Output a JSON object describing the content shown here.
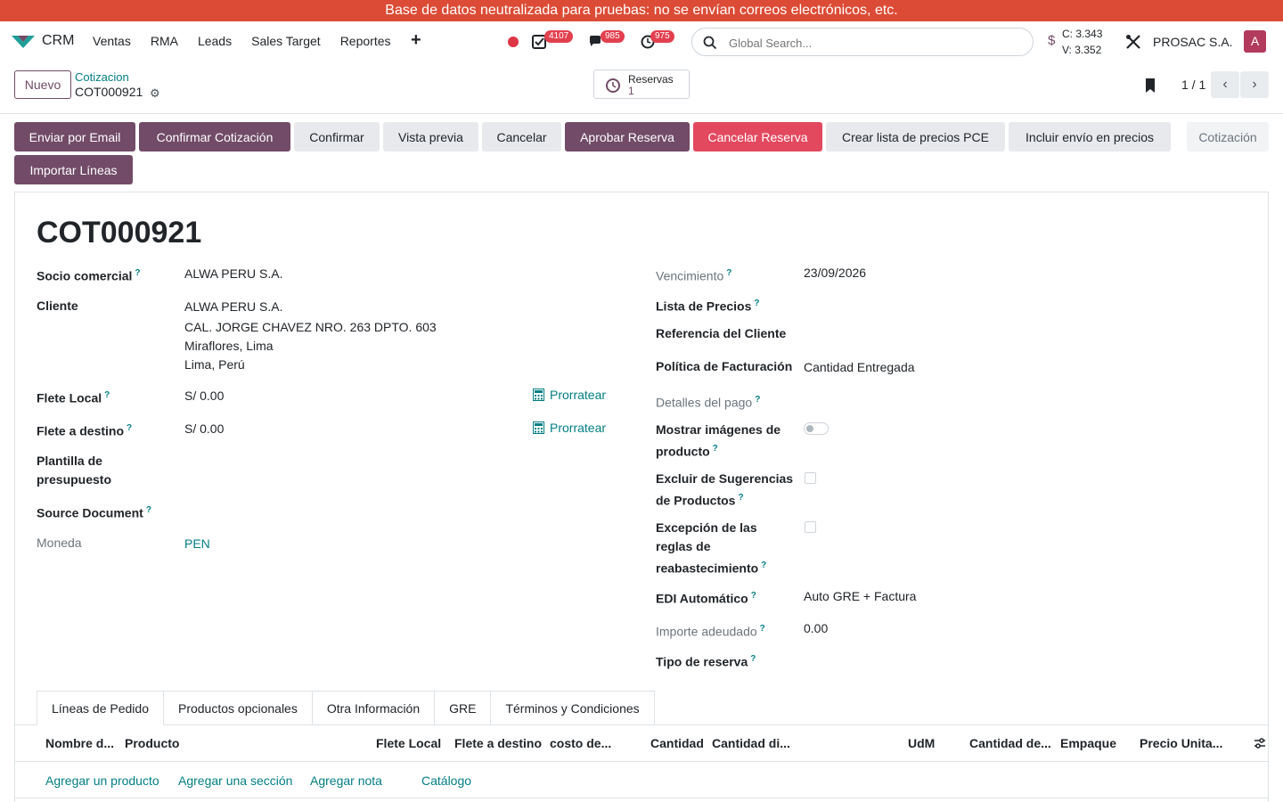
{
  "banner": "Base de datos neutralizada para pruebas: no se envían correos electrónicos, etc.",
  "navbar": {
    "app_name": "CRM",
    "menu": [
      "Ventas",
      "RMA",
      "Leads",
      "Sales Target",
      "Reportes"
    ],
    "badges": {
      "activities": "4107",
      "messages": "985",
      "timers": "975"
    },
    "search_placeholder": "Global Search...",
    "currency_symbol": "$",
    "rate_buy": "C: 3.343",
    "rate_sell": "V: 3.352",
    "company": "PROSAC S.A.",
    "avatar_initial": "A"
  },
  "control": {
    "new_label": "Nuevo",
    "breadcrumb_parent": "Cotizacion",
    "breadcrumb_current": "COT000921",
    "reservas_label": "Reservas",
    "reservas_count": "1",
    "pager": "1 / 1"
  },
  "actions": {
    "send_email": "Enviar por Email",
    "confirm_quote": "Confirmar Cotización",
    "confirm": "Confirmar",
    "preview": "Vista previa",
    "cancel": "Cancelar",
    "approve_reservation": "Aprobar Reserva",
    "cancel_reservation": "Cancelar Reserva",
    "create_pricelist": "Crear lista de precios PCE",
    "include_shipping": "Incluir envío en precios",
    "status": "Cotización",
    "import_lines": "Importar Líneas"
  },
  "form": {
    "title": "COT000921",
    "partner_label": "Socio comercial",
    "partner": "ALWA PERU S.A.",
    "client_label": "Cliente",
    "client_name": "ALWA PERU S.A.",
    "client_street": "CAL. JORGE CHAVEZ NRO. 263 DPTO. 603",
    "client_city": "Miraflores, Lima",
    "client_country": "Lima, Perú",
    "local_freight_label": "Flete Local",
    "local_freight": "S/ 0.00",
    "dest_freight_label": "Flete a destino",
    "dest_freight": "S/ 0.00",
    "prorate": "Prorratear",
    "template_label": "Plantilla de presupuesto",
    "source_label": "Source Document",
    "currency_label": "Moneda",
    "currency": "PEN",
    "expiration_label": "Vencimiento",
    "expiration": "23/09/2026",
    "pricelist_label": "Lista de Precios",
    "customer_ref_label": "Referencia del Cliente",
    "invoice_policy_label": "Política de Facturación",
    "invoice_policy": "Cantidad Entregada",
    "payment_details_label": "Detalles del pago",
    "show_images_label": "Mostrar imágenes de producto",
    "exclude_suggestions_label": "Excluir de Sugerencias de Productos",
    "replenish_exception_label": "Excepción de las reglas de reabastecimiento",
    "edi_label": "EDI Automático",
    "edi": "Auto GRE + Factura",
    "amount_due_label": "Importe adeudado",
    "amount_due": "0.00",
    "reservation_type_label": "Tipo de reserva"
  },
  "tabs": [
    "Líneas de Pedido",
    "Productos opcionales",
    "Otra Información",
    "GRE",
    "Términos y Condiciones"
  ],
  "table": {
    "columns": [
      "Nombre d...",
      "Producto",
      "Flete Local",
      "Flete a destino",
      "costo de...",
      "Cantidad",
      "Cantidad di...",
      "UdM",
      "Cantidad de...",
      "Empaque",
      "Precio Unita..."
    ],
    "add_links": [
      "Agregar un producto",
      "Agregar una sección",
      "Agregar nota",
      "Catálogo"
    ]
  },
  "colors": {
    "brand": "#714b67",
    "link": "#017e84",
    "banner": "#dc4b35",
    "danger": "#e2495f"
  }
}
